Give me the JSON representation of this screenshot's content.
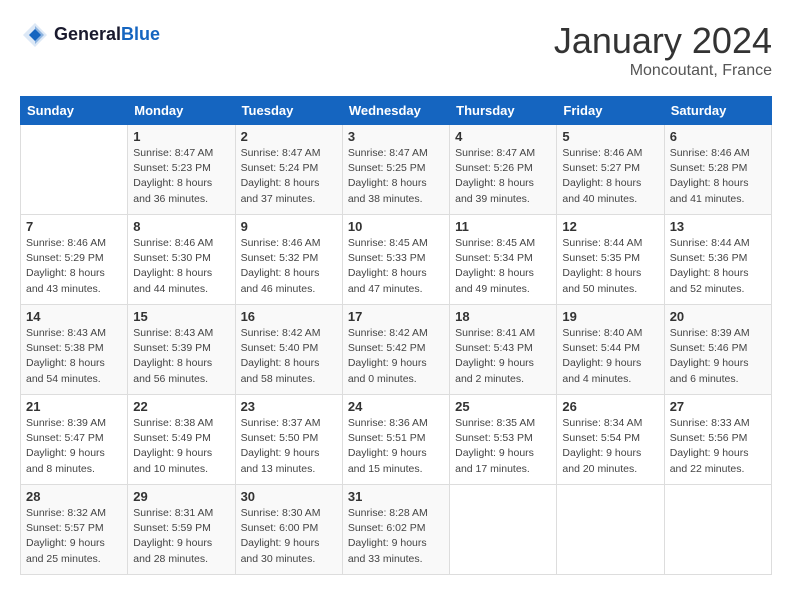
{
  "header": {
    "logo_general": "General",
    "logo_blue": "Blue",
    "month": "January 2024",
    "location": "Moncoutant, France"
  },
  "days_of_week": [
    "Sunday",
    "Monday",
    "Tuesday",
    "Wednesday",
    "Thursday",
    "Friday",
    "Saturday"
  ],
  "weeks": [
    [
      {
        "day": "",
        "info": ""
      },
      {
        "day": "1",
        "info": "Sunrise: 8:47 AM\nSunset: 5:23 PM\nDaylight: 8 hours\nand 36 minutes."
      },
      {
        "day": "2",
        "info": "Sunrise: 8:47 AM\nSunset: 5:24 PM\nDaylight: 8 hours\nand 37 minutes."
      },
      {
        "day": "3",
        "info": "Sunrise: 8:47 AM\nSunset: 5:25 PM\nDaylight: 8 hours\nand 38 minutes."
      },
      {
        "day": "4",
        "info": "Sunrise: 8:47 AM\nSunset: 5:26 PM\nDaylight: 8 hours\nand 39 minutes."
      },
      {
        "day": "5",
        "info": "Sunrise: 8:46 AM\nSunset: 5:27 PM\nDaylight: 8 hours\nand 40 minutes."
      },
      {
        "day": "6",
        "info": "Sunrise: 8:46 AM\nSunset: 5:28 PM\nDaylight: 8 hours\nand 41 minutes."
      }
    ],
    [
      {
        "day": "7",
        "info": "Sunrise: 8:46 AM\nSunset: 5:29 PM\nDaylight: 8 hours\nand 43 minutes."
      },
      {
        "day": "8",
        "info": "Sunrise: 8:46 AM\nSunset: 5:30 PM\nDaylight: 8 hours\nand 44 minutes."
      },
      {
        "day": "9",
        "info": "Sunrise: 8:46 AM\nSunset: 5:32 PM\nDaylight: 8 hours\nand 46 minutes."
      },
      {
        "day": "10",
        "info": "Sunrise: 8:45 AM\nSunset: 5:33 PM\nDaylight: 8 hours\nand 47 minutes."
      },
      {
        "day": "11",
        "info": "Sunrise: 8:45 AM\nSunset: 5:34 PM\nDaylight: 8 hours\nand 49 minutes."
      },
      {
        "day": "12",
        "info": "Sunrise: 8:44 AM\nSunset: 5:35 PM\nDaylight: 8 hours\nand 50 minutes."
      },
      {
        "day": "13",
        "info": "Sunrise: 8:44 AM\nSunset: 5:36 PM\nDaylight: 8 hours\nand 52 minutes."
      }
    ],
    [
      {
        "day": "14",
        "info": "Sunrise: 8:43 AM\nSunset: 5:38 PM\nDaylight: 8 hours\nand 54 minutes."
      },
      {
        "day": "15",
        "info": "Sunrise: 8:43 AM\nSunset: 5:39 PM\nDaylight: 8 hours\nand 56 minutes."
      },
      {
        "day": "16",
        "info": "Sunrise: 8:42 AM\nSunset: 5:40 PM\nDaylight: 8 hours\nand 58 minutes."
      },
      {
        "day": "17",
        "info": "Sunrise: 8:42 AM\nSunset: 5:42 PM\nDaylight: 9 hours\nand 0 minutes."
      },
      {
        "day": "18",
        "info": "Sunrise: 8:41 AM\nSunset: 5:43 PM\nDaylight: 9 hours\nand 2 minutes."
      },
      {
        "day": "19",
        "info": "Sunrise: 8:40 AM\nSunset: 5:44 PM\nDaylight: 9 hours\nand 4 minutes."
      },
      {
        "day": "20",
        "info": "Sunrise: 8:39 AM\nSunset: 5:46 PM\nDaylight: 9 hours\nand 6 minutes."
      }
    ],
    [
      {
        "day": "21",
        "info": "Sunrise: 8:39 AM\nSunset: 5:47 PM\nDaylight: 9 hours\nand 8 minutes."
      },
      {
        "day": "22",
        "info": "Sunrise: 8:38 AM\nSunset: 5:49 PM\nDaylight: 9 hours\nand 10 minutes."
      },
      {
        "day": "23",
        "info": "Sunrise: 8:37 AM\nSunset: 5:50 PM\nDaylight: 9 hours\nand 13 minutes."
      },
      {
        "day": "24",
        "info": "Sunrise: 8:36 AM\nSunset: 5:51 PM\nDaylight: 9 hours\nand 15 minutes."
      },
      {
        "day": "25",
        "info": "Sunrise: 8:35 AM\nSunset: 5:53 PM\nDaylight: 9 hours\nand 17 minutes."
      },
      {
        "day": "26",
        "info": "Sunrise: 8:34 AM\nSunset: 5:54 PM\nDaylight: 9 hours\nand 20 minutes."
      },
      {
        "day": "27",
        "info": "Sunrise: 8:33 AM\nSunset: 5:56 PM\nDaylight: 9 hours\nand 22 minutes."
      }
    ],
    [
      {
        "day": "28",
        "info": "Sunrise: 8:32 AM\nSunset: 5:57 PM\nDaylight: 9 hours\nand 25 minutes."
      },
      {
        "day": "29",
        "info": "Sunrise: 8:31 AM\nSunset: 5:59 PM\nDaylight: 9 hours\nand 28 minutes."
      },
      {
        "day": "30",
        "info": "Sunrise: 8:30 AM\nSunset: 6:00 PM\nDaylight: 9 hours\nand 30 minutes."
      },
      {
        "day": "31",
        "info": "Sunrise: 8:28 AM\nSunset: 6:02 PM\nDaylight: 9 hours\nand 33 minutes."
      },
      {
        "day": "",
        "info": ""
      },
      {
        "day": "",
        "info": ""
      },
      {
        "day": "",
        "info": ""
      }
    ]
  ]
}
